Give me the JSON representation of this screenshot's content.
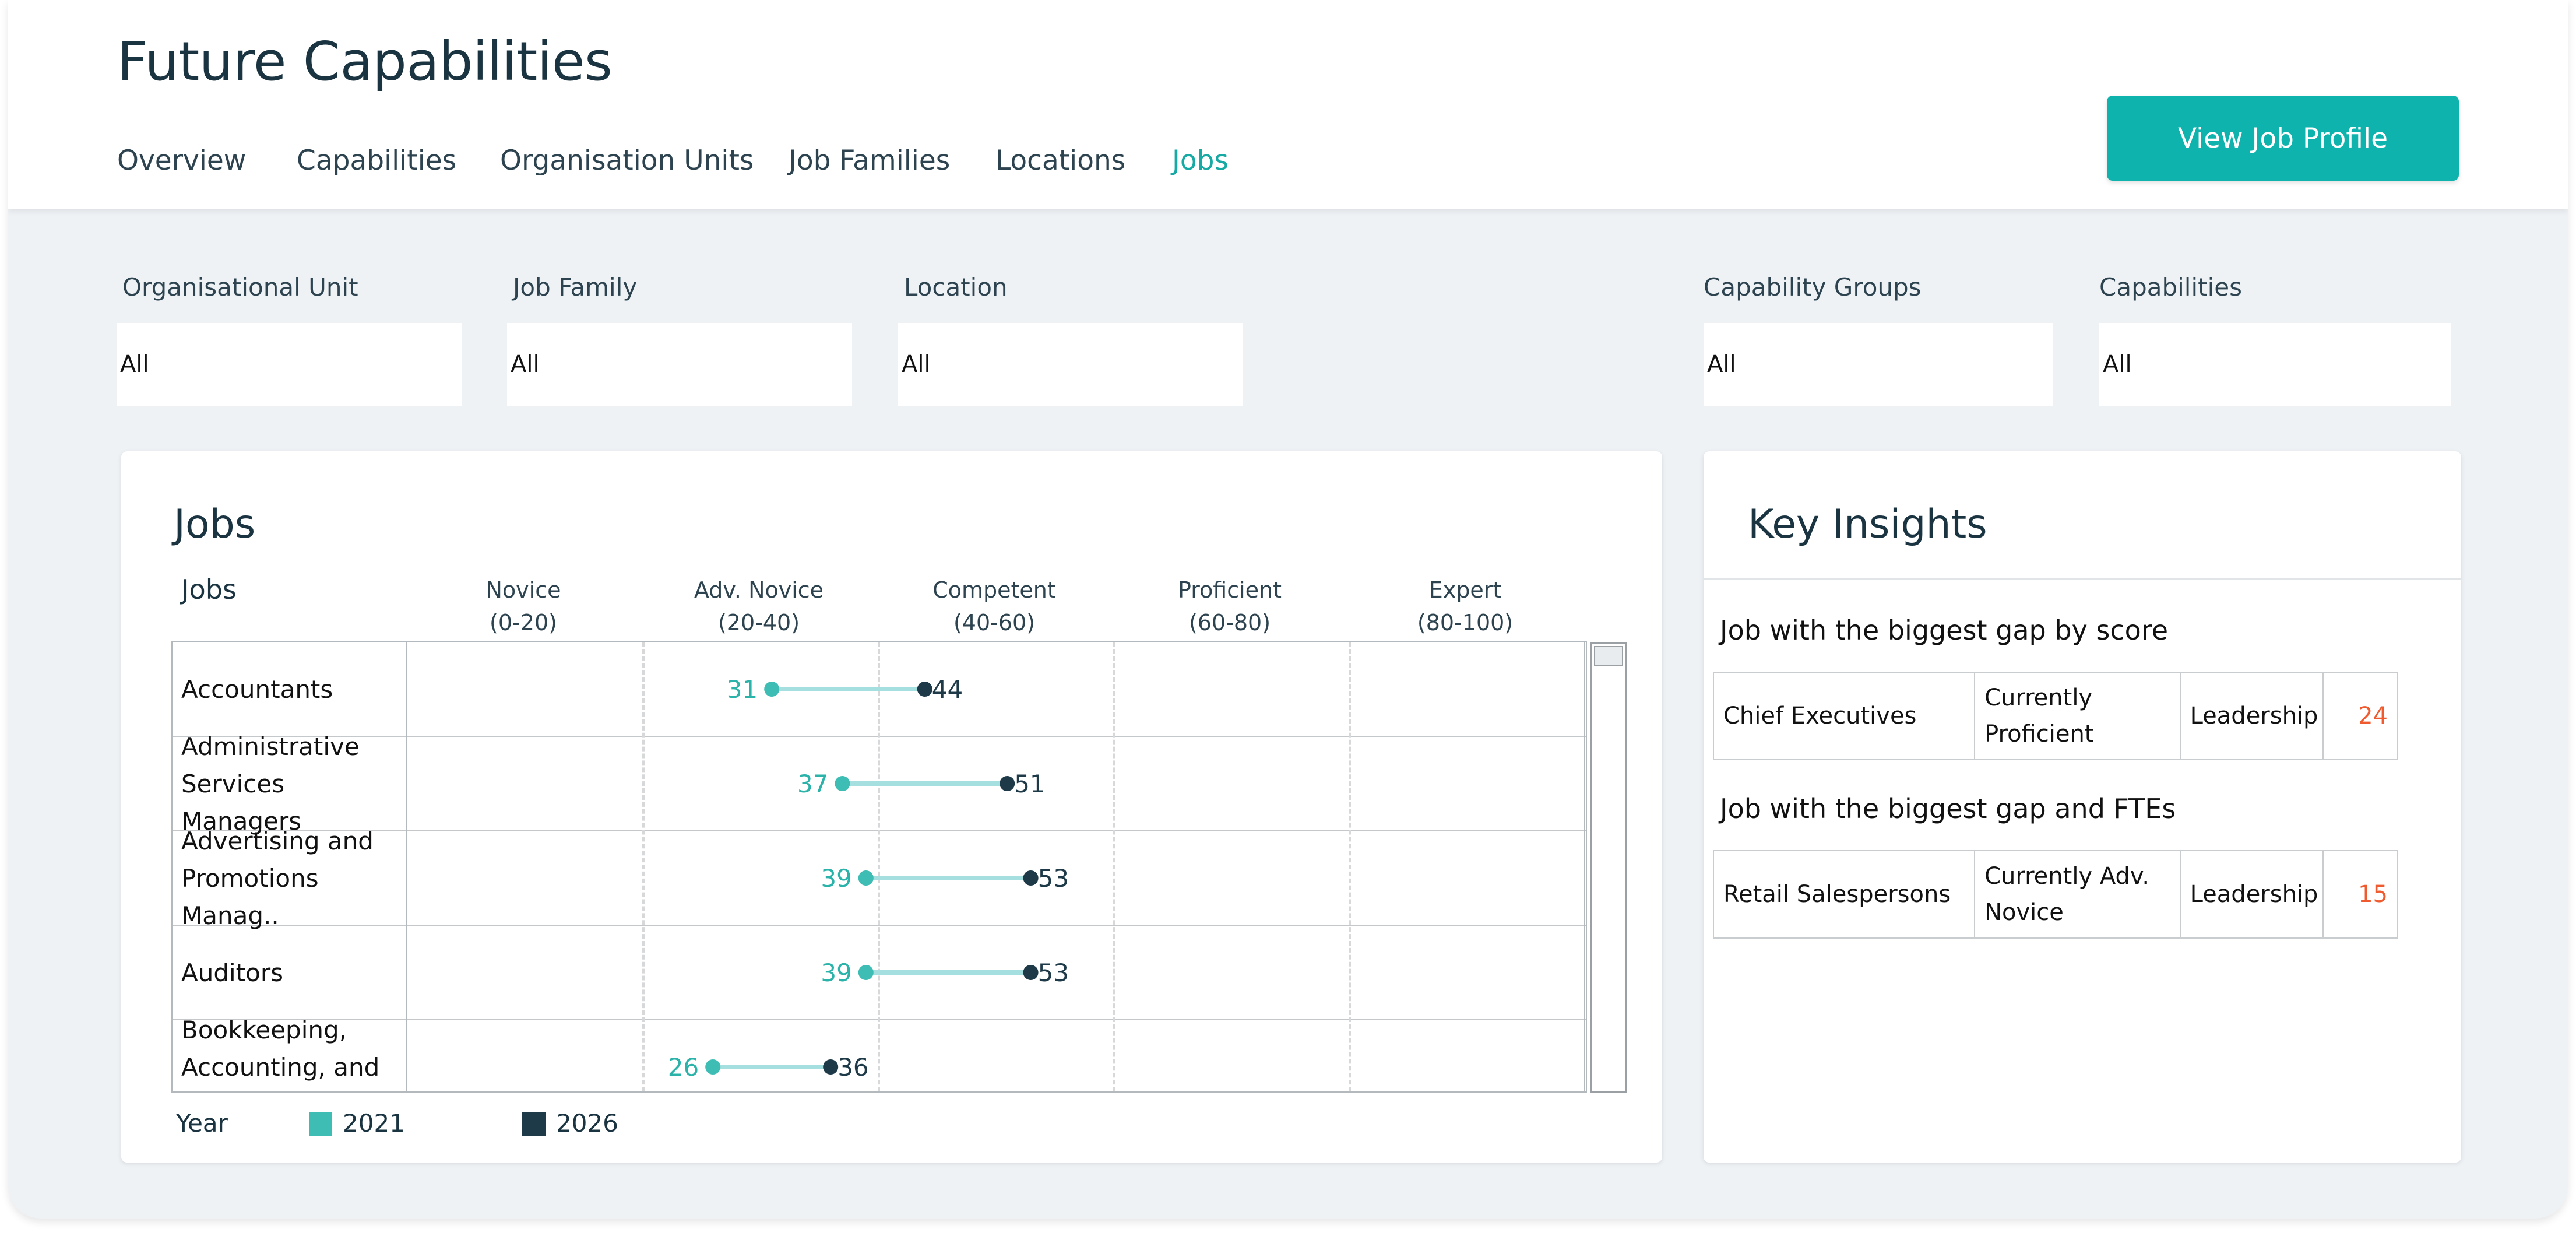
{
  "header": {
    "title": "Future Capabilities",
    "tabs": [
      "Overview",
      "Capabilities",
      "Organisation Units",
      "Job Families",
      "Locations",
      "Jobs"
    ],
    "active_tab": "Jobs",
    "view_job_profile_label": "View Job Profile"
  },
  "filters": {
    "org_unit": {
      "label": "Organisational Unit",
      "value": "All"
    },
    "job_family": {
      "label": "Job Family",
      "value": "All"
    },
    "location": {
      "label": "Location",
      "value": "All"
    },
    "capability_groups": {
      "label": "Capability Groups",
      "value": "All"
    },
    "capabilities": {
      "label": "Capabilities",
      "value": "All"
    }
  },
  "jobs_panel": {
    "title": "Jobs",
    "column_header": "Jobs",
    "levels": [
      {
        "name": "Novice",
        "range": "(0-20)"
      },
      {
        "name": "Adv. Novice",
        "range": "(20-40)"
      },
      {
        "name": "Competent",
        "range": "(40-60)"
      },
      {
        "name": "Proficient",
        "range": "(60-80)"
      },
      {
        "name": "Expert",
        "range": "(80-100)"
      }
    ],
    "rows": [
      {
        "job": "Accountants",
        "y2021": 31,
        "y2026": 44
      },
      {
        "job": "Administrative Services Managers",
        "y2021": 37,
        "y2026": 51
      },
      {
        "job": "Advertising and Promotions Manag..",
        "y2021": 39,
        "y2026": 53
      },
      {
        "job": "Auditors",
        "y2021": 39,
        "y2026": 53
      },
      {
        "job": "Bookkeeping, Accounting, and Au..",
        "y2021": 26,
        "y2026": 36
      }
    ],
    "legend": {
      "title": "Year",
      "items": [
        {
          "label": "2021",
          "color": "#3dbdb3"
        },
        {
          "label": "2026",
          "color": "#1e3a48"
        }
      ]
    }
  },
  "chart_data": {
    "type": "dumbbell",
    "categories": [
      "Accountants",
      "Administrative Services Managers",
      "Advertising and Promotions Manag..",
      "Auditors",
      "Bookkeeping, Accounting, and Au.."
    ],
    "series": [
      {
        "name": "2021",
        "values": [
          31,
          37,
          39,
          39,
          26
        ],
        "color": "#3dbdb3"
      },
      {
        "name": "2026",
        "values": [
          44,
          51,
          53,
          53,
          36
        ],
        "color": "#1e3a48"
      }
    ],
    "xlim": [
      0,
      100
    ],
    "x_bands": [
      "Novice (0-20)",
      "Adv. Novice (20-40)",
      "Competent (40-60)",
      "Proficient (60-80)",
      "Expert (80-100)"
    ],
    "connector_color": "#a6dfe0"
  },
  "insights": {
    "title": "Key Insights",
    "items": [
      {
        "heading": "Job with the biggest gap by score",
        "job": "Chief Executives",
        "current": "Currently Proficient",
        "group": "Leadership",
        "score": "24"
      },
      {
        "heading": "Job with the biggest gap and FTEs",
        "job": "Retail Salespersons",
        "current": "Currently Adv. Novice",
        "group": "Leadership",
        "score": "15"
      }
    ]
  }
}
